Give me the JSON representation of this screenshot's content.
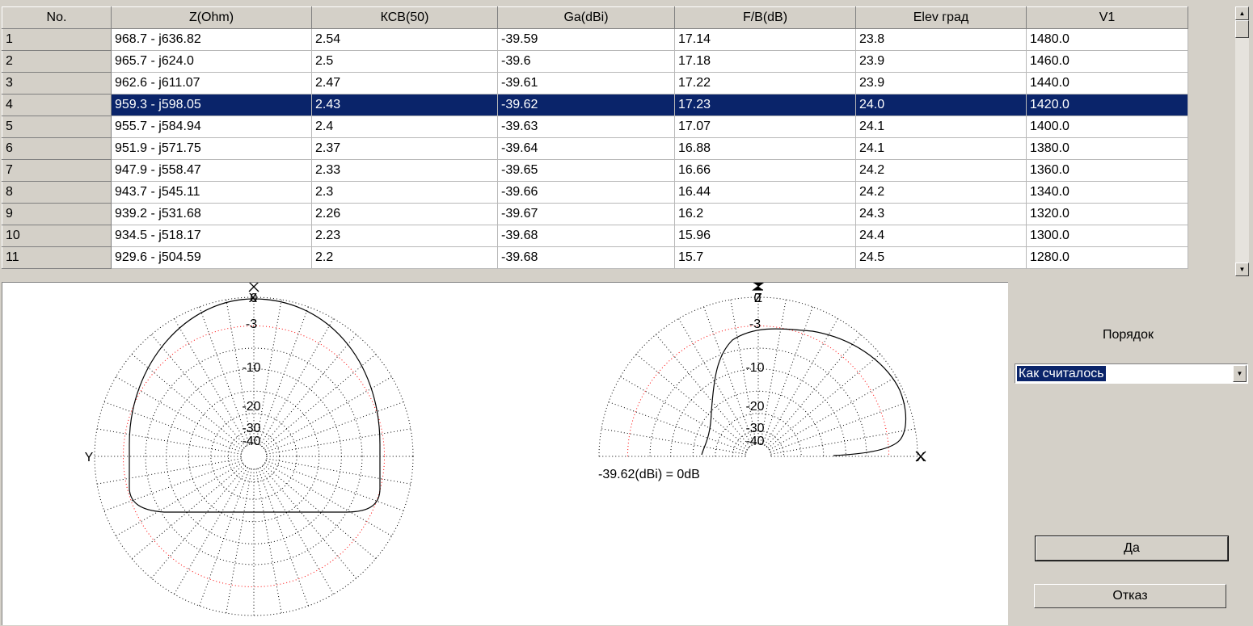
{
  "table": {
    "columns": [
      "No.",
      "Z(Ohm)",
      "КСВ(50)",
      "Ga(dBi)",
      "F/B(dB)",
      "Elev град",
      "V1"
    ],
    "selected_row": 3,
    "rows": [
      [
        "1",
        "968.7 - j636.82",
        "2.54",
        "-39.59",
        "17.14",
        "23.8",
        "1480.0"
      ],
      [
        "2",
        "965.7 - j624.0",
        "2.5",
        "-39.6",
        "17.18",
        "23.9",
        "1460.0"
      ],
      [
        "3",
        "962.6 - j611.07",
        "2.47",
        "-39.61",
        "17.22",
        "23.9",
        "1440.0"
      ],
      [
        "4",
        "959.3 - j598.05",
        "2.43",
        "-39.62",
        "17.23",
        "24.0",
        "1420.0"
      ],
      [
        "5",
        "955.7 - j584.94",
        "2.4",
        "-39.63",
        "17.07",
        "24.1",
        "1400.0"
      ],
      [
        "6",
        "951.9 - j571.75",
        "2.37",
        "-39.64",
        "16.88",
        "24.1",
        "1380.0"
      ],
      [
        "7",
        "947.9 - j558.47",
        "2.33",
        "-39.65",
        "16.66",
        "24.2",
        "1360.0"
      ],
      [
        "8",
        "943.7 - j545.11",
        "2.3",
        "-39.66",
        "16.44",
        "24.2",
        "1340.0"
      ],
      [
        "9",
        "939.2 - j531.68",
        "2.26",
        "-39.67",
        "16.2",
        "24.3",
        "1320.0"
      ],
      [
        "10",
        "934.5 - j518.17",
        "2.23",
        "-39.68",
        "15.96",
        "24.4",
        "1300.0"
      ],
      [
        "11",
        "929.6 - j504.59",
        "2.2",
        "-39.68",
        "15.7",
        "24.5",
        "1280.0"
      ]
    ]
  },
  "plots": {
    "scale_labels": [
      "0",
      "-3",
      "-10",
      "-20",
      "-30",
      "-40"
    ],
    "horizontal": {
      "top_axis": "X",
      "left_axis": "Y"
    },
    "vertical": {
      "top_axis": "Z",
      "right_axis": "X"
    },
    "reference_text": "-39.62(dBi) = 0dB"
  },
  "side_panel": {
    "order_label": "Порядок",
    "order_value": "Как считалось",
    "ok_label": "Да",
    "cancel_label": "Отказ"
  },
  "colors": {
    "selection": "#0a246a",
    "face": "#d4d0c8",
    "grid_ring": "#000000",
    "minus3_ring": "#ff0000"
  }
}
